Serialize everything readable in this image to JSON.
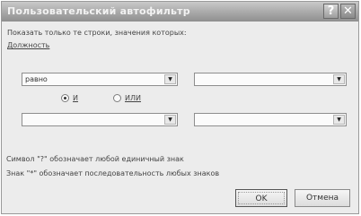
{
  "dialog": {
    "title": "Пользовательский автофильтр",
    "help_glyph": "?",
    "close_glyph": "✕"
  },
  "criteria": {
    "instruction": "Показать только те строки, значения которых:",
    "field_label": "Должность",
    "row1": {
      "operator": "равно",
      "value": ""
    },
    "logic": {
      "and_label": "И",
      "or_label": "ИЛИ",
      "selected": "И"
    },
    "row2": {
      "operator": "",
      "value": ""
    }
  },
  "hints": {
    "question_mark": "Символ \"?\" обозначает любой единичный знак",
    "asterisk": "Знак \"*\" обозначает последовательность любых знаков"
  },
  "buttons": {
    "ok": "OK",
    "cancel": "Отмена"
  }
}
